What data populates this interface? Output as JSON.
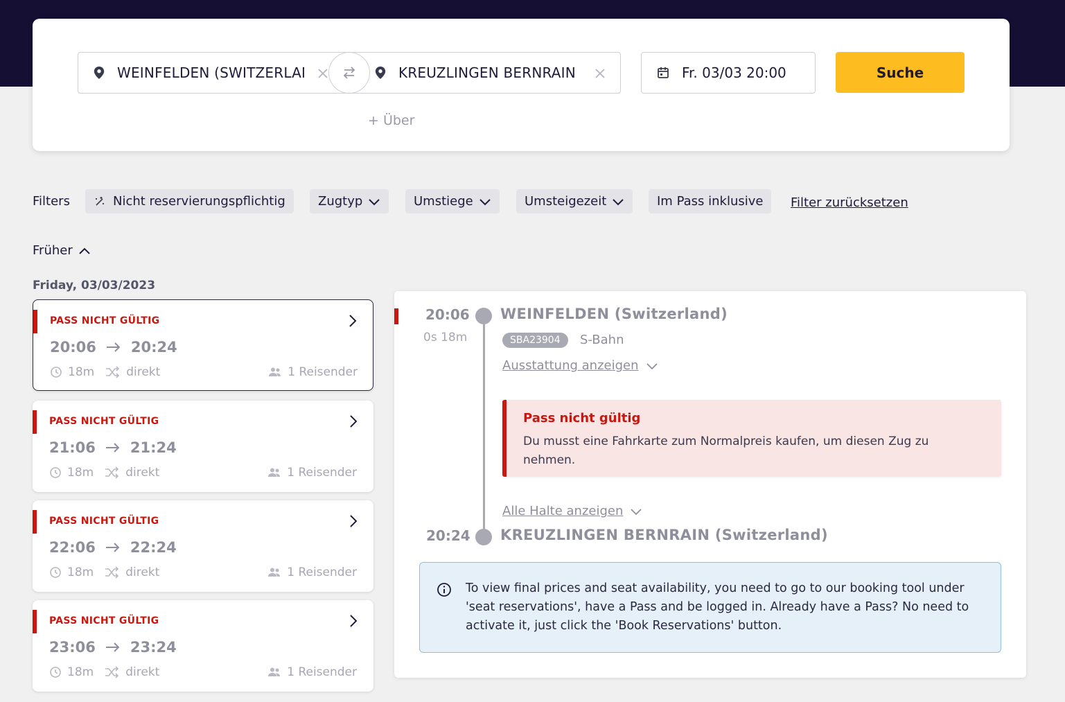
{
  "search": {
    "origin": "WEINFELDEN (SWITZERLAND)",
    "destination": "KREUZLINGEN BERNRAIN (SWITZERLAND)",
    "date": "Fr. 03/03 20:00",
    "search_label": "Suche",
    "via_label": "+ Über"
  },
  "filters": {
    "label": "Filters",
    "chips": [
      "Nicht reservierungspflichtig",
      "Zugtyp",
      "Umstiege",
      "Umsteigezeit",
      "Im Pass inklusive"
    ],
    "reset_label": "Filter zurücksetzen"
  },
  "earlier_label": "Früher",
  "date_heading": "Friday, 03/03/2023",
  "journeys": [
    {
      "status": "PASS NICHT GÜLTIG",
      "dep": "20:06",
      "arr": "20:24",
      "duration": "18m",
      "changes": "direkt",
      "travellers": "1 Reisender"
    },
    {
      "status": "PASS NICHT GÜLTIG",
      "dep": "21:06",
      "arr": "21:24",
      "duration": "18m",
      "changes": "direkt",
      "travellers": "1 Reisender"
    },
    {
      "status": "PASS NICHT GÜLTIG",
      "dep": "22:06",
      "arr": "22:24",
      "duration": "18m",
      "changes": "direkt",
      "travellers": "1 Reisender"
    },
    {
      "status": "PASS NICHT GÜLTIG",
      "dep": "23:06",
      "arr": "23:24",
      "duration": "18m",
      "changes": "direkt",
      "travellers": "1 Reisender"
    }
  ],
  "detail": {
    "dep_time": "20:06",
    "duration": "0s 18m",
    "dep_station": "WEINFELDEN (Switzerland)",
    "train_number": "SBA23904",
    "train_type": "S-Bahn",
    "amenities_link": "Ausstattung anzeigen",
    "warning_title": "Pass nicht gültig",
    "warning_text": "Du musst eine Fahrkarte zum Normalpreis kaufen, um diesen Zug zu nehmen.",
    "stops_link": "Alle Halte anzeigen",
    "arr_time": "20:24",
    "arr_station": "KREUZLINGEN BERNRAIN (Switzerland)",
    "info_text": "To view final prices and seat availability, you need to go to our booking tool under 'seat reservations', have a Pass and be logged in. Already have a Pass? No need to activate it, just click the 'Book Reservations' button."
  },
  "colors": {
    "header": "#150f33",
    "accent": "#fdbd20",
    "error": "#c8180f",
    "info_bg": "#e6f0f8"
  }
}
